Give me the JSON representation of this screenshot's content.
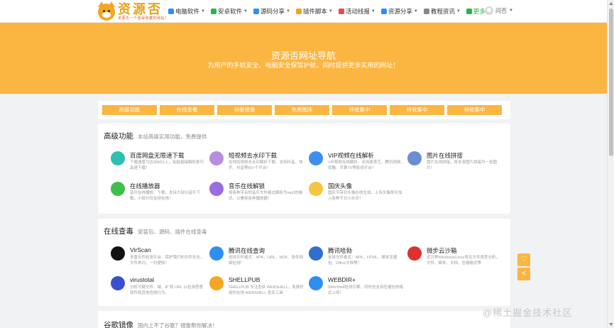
{
  "logo": {
    "title": "资源否",
    "subtitle": "资源否一个值得收藏的网站！"
  },
  "nav": [
    {
      "label": "电脑软件",
      "icon": "windows-icon",
      "color": "#2f8ff0"
    },
    {
      "label": "安卓软件",
      "icon": "android-icon",
      "color": "#2ab34a"
    },
    {
      "label": "源码分享",
      "icon": "code-icon",
      "color": "#2f8ff0"
    },
    {
      "label": "插件脚本",
      "icon": "plugin-icon",
      "color": "#f0a31b"
    },
    {
      "label": "活动线报",
      "icon": "activity-icon",
      "color": "#e84b4b"
    },
    {
      "label": "资源分享",
      "icon": "send-icon",
      "color": "#2f8ff0"
    },
    {
      "label": "教程资讯",
      "icon": "book-icon",
      "color": "#888888"
    },
    {
      "label": "更多",
      "icon": "more-icon",
      "color": "#2ab34a"
    }
  ],
  "user": {
    "name": "问否"
  },
  "hero": {
    "title": "资源否网址导航",
    "subtitle": "为用户的手机安全、电脑安全保驾护航，同时提供更多实用的网址！"
  },
  "tabs": [
    "高级功能",
    "在线查看",
    "谷歌镜像",
    "免费图床",
    "待收集中",
    "待收集中",
    "待收集中"
  ],
  "sections": [
    {
      "title": "高级功能",
      "desc": "本站高级实用功能，免费提供",
      "items": [
        {
          "title": "百度网盘无限速下载",
          "desc": "下载速度可达30M以上，粘贴链接解析即可高速下载！",
          "icon": "cloud-download-icon",
          "color": "#2ec0b0"
        },
        {
          "title": "短视频去水印下载",
          "desc": "在线短视频去水印解析下载，支持抖音、快手、抖音等60+个平台！",
          "icon": "video-icon",
          "color": "#b58ee0"
        },
        {
          "title": "VIP视频在线解析",
          "desc": "VIP视频在线解析，支持爱奇艺、腾讯视频、优酷、芒果TV等影视平台！",
          "icon": "play-icon",
          "color": "#3d8ef0"
        },
        {
          "title": "图片在线拼接",
          "desc": "图片在线拼接，将多张图片拼接为一张图片！",
          "icon": "image-grid-icon",
          "color": "#6a8fd0"
        },
        {
          "title": "在线播放器",
          "desc": "音乐在线播放、下载，支持大部分音乐下载，小部分仅支持在线！",
          "icon": "music-player-icon",
          "color": "#3dc04a"
        },
        {
          "title": "音乐在线解锁",
          "desc": "将各种平台的音乐文件格式解析为mp3的格式，以兼容各种播放器！",
          "icon": "unlock-icon",
          "color": "#9b6be0"
        },
        {
          "title": "国庆头像",
          "desc": "国庆节带日头像在线生成，上传头像即可加入各种节日小水印！",
          "icon": "avatar-flag-icon",
          "color": "#f5c542"
        }
      ]
    },
    {
      "title": "在线查毒",
      "desc": "安装包、源码、插件在线查毒",
      "items": [
        {
          "title": "VirScan",
          "desc": "多重文件检测平台，保护我们的文件安全，文件再归，一扫便知！",
          "icon": "virscan-icon",
          "color": "#111111"
        },
        {
          "title": "腾讯在线查询",
          "desc": "支持文件格式：APK、URL、MD5、软件网络检测！",
          "icon": "shield-check-icon",
          "color": "#2f8ff0"
        },
        {
          "title": "腾讯哈勃",
          "desc": "支持文件格式：APK、HTML、脚本压缩包、Office文档等！",
          "icon": "hubble-icon",
          "color": "#2f6fd0"
        },
        {
          "title": "微步云沙箱",
          "desc": "近万种Windows/Linux常见文件类型分析，文件、脚本、文档、压缩格式等",
          "icon": "sandbox-icon",
          "color": "#e03030"
        },
        {
          "title": "virustotal",
          "desc": "分析可疑文件、域、IP 和 URL 以检测恶意软件和其他违规行为。",
          "icon": "virustotal-icon",
          "color": "#3a4fd0"
        },
        {
          "title": "SHELLPUB",
          "desc": "SHELLPUB 专注查杀 WEBSHELL，免费好用的在线 WEBSHELL 查杀工具",
          "icon": "shellpub-cloud-icon",
          "color": "#f5a623"
        },
        {
          "title": "WEBDIR+",
          "desc": "WebShell检测引擎，同时也支持压缩包的格式上传！",
          "icon": "webdir-icon",
          "color": "#2f8ff0"
        }
      ]
    },
    {
      "title": "谷歌镜像",
      "desc": "国内上不了谷歌？镜像帮你解决！",
      "items": []
    }
  ],
  "float_buttons": [
    {
      "icon": "heart-icon",
      "glyph": "♡"
    },
    {
      "icon": "share-icon",
      "glyph": "<"
    }
  ],
  "watermark": "@稀土掘金技术社区"
}
